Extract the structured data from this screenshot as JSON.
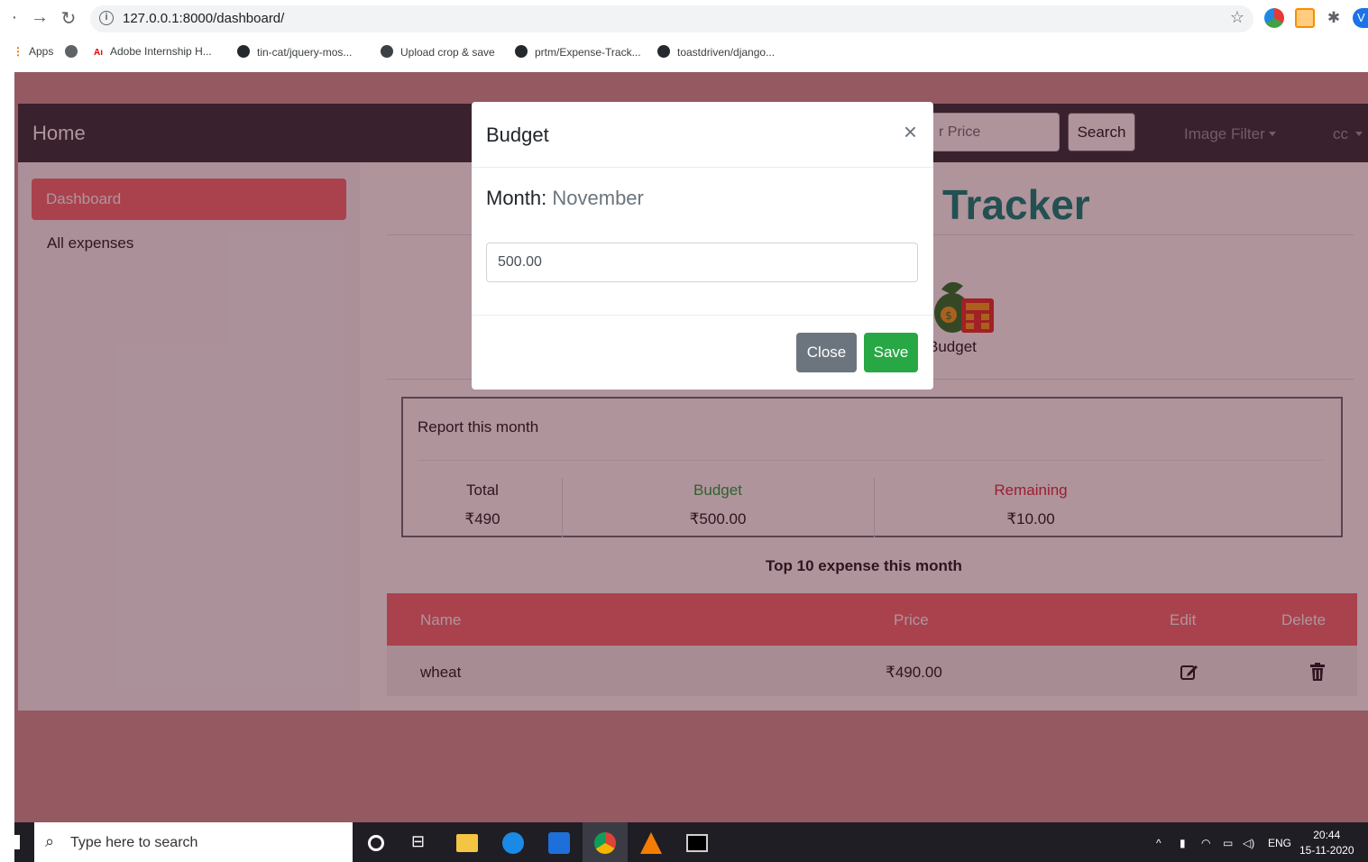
{
  "browser": {
    "url": "127.0.0.1:8000/dashboard/",
    "bookmarks": [
      "Apps",
      "Adobe Internship H...",
      "tin-cat/jquery-mos...",
      "Upload crop & save",
      "prtm/Expense-Track...",
      "toastdriven/django..."
    ],
    "profile_initial": "V"
  },
  "navbar": {
    "brand": "Home",
    "search_placeholder": "r Price",
    "search_button": "Search",
    "image_filter": "Image Filter",
    "user": "cc"
  },
  "sidebar": {
    "items": [
      "Dashboard",
      "All expenses"
    ]
  },
  "main": {
    "title": "Tracker",
    "budget_caption": "Budget",
    "report": {
      "heading": "Report this month",
      "total_label": "Total",
      "total_value": "₹490",
      "budget_label": "Budget",
      "budget_value": "₹500.00",
      "remaining_label": "Remaining",
      "remaining_value": "₹10.00"
    },
    "top10_heading": "Top 10 expense this month",
    "table": {
      "headers": [
        "Name",
        "Price",
        "Edit",
        "Delete"
      ],
      "rows": [
        {
          "name": "wheat",
          "price": "₹490.00"
        }
      ]
    }
  },
  "modal": {
    "title": "Budget",
    "close_x": "×",
    "month_label": "Month:",
    "month_value": "November",
    "budget_value": "500.00",
    "close_button": "Close",
    "save_button": "Save"
  },
  "taskbar": {
    "search_placeholder": "Type here to search",
    "lang": "ENG",
    "time": "20:44",
    "date": "15-11-2020"
  },
  "colors": {
    "accent": "#f47378",
    "title_teal": "#0f8a7d",
    "budget_green": "#28a745",
    "remaining_red": "#dc3545",
    "navbar_dark": "#343a40"
  },
  "icons": [
    "back-arrow-icon",
    "forward-arrow-icon",
    "reload-icon",
    "info-icon",
    "star-icon",
    "github-icon",
    "edit-icon",
    "trash-icon",
    "search-icon",
    "budget-money-icon"
  ]
}
